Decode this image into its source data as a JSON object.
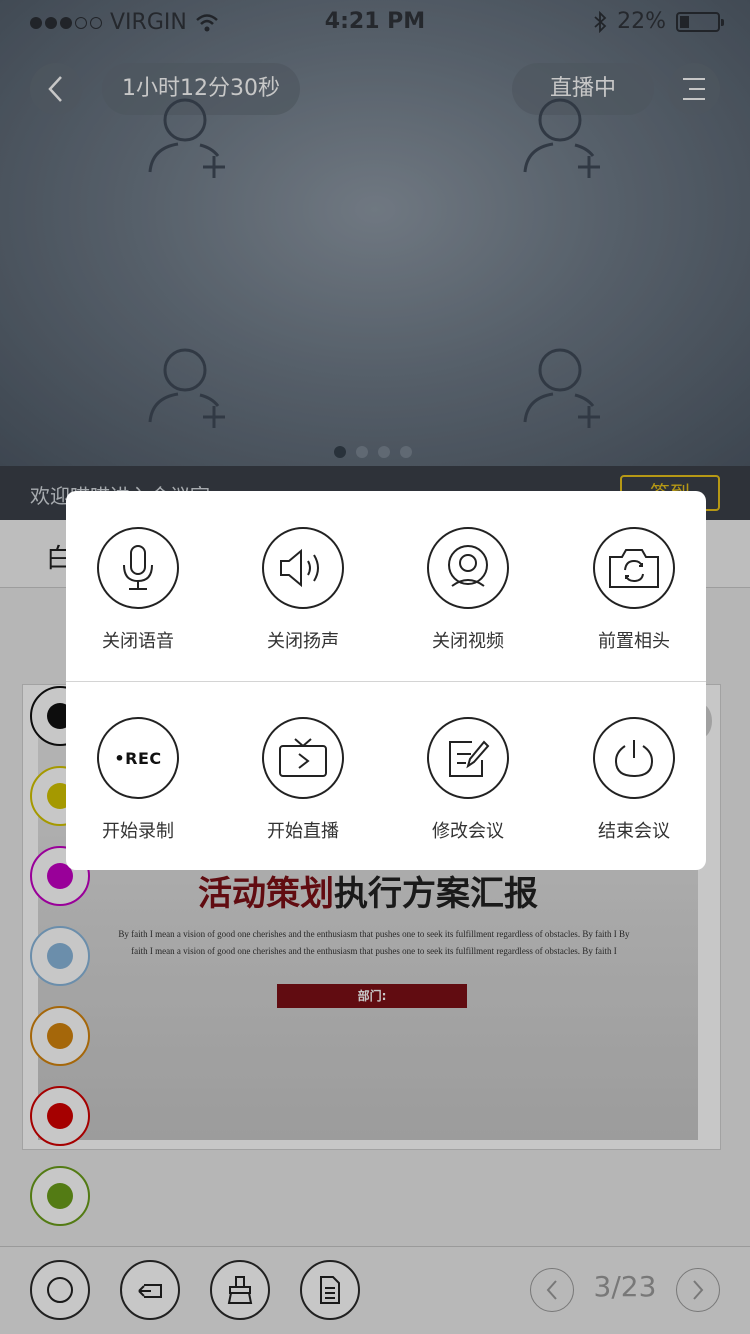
{
  "status_bar": {
    "carrier": "VIRGIN",
    "time": "4:21 PM",
    "battery": "22%",
    "icons": [
      "signal-dots-icon",
      "wifi-icon",
      "bluetooth-icon",
      "battery-icon"
    ]
  },
  "header": {
    "duration": "1小时12分30秒",
    "live_status": "直播中",
    "icons": [
      "back-arrow-icon",
      "menu-icon"
    ]
  },
  "video_slots": {
    "icon": "add-user-icon",
    "page_count": 4,
    "active_page": 1
  },
  "welcome": {
    "text": "欢迎喵喵进入会议室",
    "signin_label": "签到"
  },
  "tabs": {
    "first_label": "白"
  },
  "slide": {
    "title_accent": "活动策划",
    "title_rest": "执行方案汇报",
    "body": "By faith I mean a vision of good one cherishes and the enthusiasm that pushes one to seek its fulfillment regardless of obstacles. By faith I By faith I mean a vision of good one cherishes and the enthusiasm that pushes one to seek its fulfillment regardless of obstacles. By faith I",
    "dept_label": "部门:"
  },
  "palette": {
    "colors": [
      "#111111",
      "#d4c400",
      "#c400c4",
      "#8ab6dc",
      "#d4840e",
      "#d40000",
      "#6b9e1a"
    ]
  },
  "actions_top": [
    {
      "label": "关闭语音",
      "icon": "microphone-icon"
    },
    {
      "label": "关闭扬声",
      "icon": "speaker-icon"
    },
    {
      "label": "关闭视频",
      "icon": "webcam-icon"
    },
    {
      "label": "前置相头",
      "icon": "camera-switch-icon"
    }
  ],
  "actions_bottom": [
    {
      "label": "开始录制",
      "icon": "record-icon",
      "badge": "•REC"
    },
    {
      "label": "开始直播",
      "icon": "tv-play-icon"
    },
    {
      "label": "修改会议",
      "icon": "edit-icon"
    },
    {
      "label": "结束会议",
      "icon": "power-icon"
    }
  ],
  "toolbar": {
    "page_indicator": "3/23",
    "icons": [
      "circle-tool-icon",
      "undo-icon",
      "eraser-icon",
      "document-icon",
      "prev-page-icon",
      "next-page-icon"
    ]
  }
}
